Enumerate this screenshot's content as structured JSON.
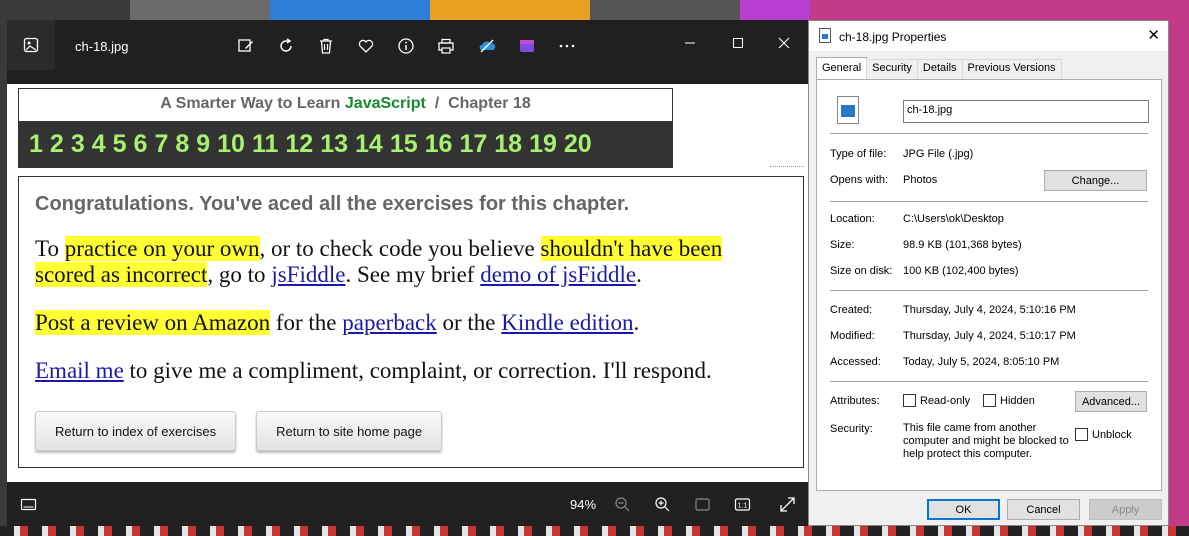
{
  "photos": {
    "file_name": "ch-18.jpg",
    "zoom": "94%",
    "toolbar_icons": [
      "edit-icon",
      "rotate-icon",
      "delete-icon",
      "favorite-icon",
      "info-icon",
      "print-icon",
      "onedrive-icon",
      "clipchamp-icon",
      "more-icon"
    ]
  },
  "page": {
    "title_prefix": "A Smarter Way to Learn",
    "title_js": "JavaScript",
    "title_sep": "/",
    "title_chapter": "Chapter 18",
    "numbers": [
      "1",
      "2",
      "3",
      "4",
      "5",
      "6",
      "7",
      "8",
      "9",
      "10",
      "11",
      "12",
      "13",
      "14",
      "15",
      "16",
      "17",
      "18",
      "19",
      "20"
    ],
    "congrats": "Congratulations. You've aced all the exercises for this chapter.",
    "p1": {
      "a": "To ",
      "hl1": "practice on your own",
      "b": ", or to check code you believe ",
      "hl2": "shouldn't have been scored as incorrect",
      "c": ", go to ",
      "link1": "jsFiddle",
      "d": ". See my brief ",
      "link2": "demo of jsFiddle",
      "e": "."
    },
    "p2": {
      "hl": "Post a review on Amazon",
      "a": " for the ",
      "link1": "paperback",
      "b": " or the ",
      "link2": "Kindle edition",
      "c": "."
    },
    "p3": {
      "link": "Email me",
      "a": " to give me a compliment, complaint, or correction. I'll respond."
    },
    "btn_index": "Return to index of exercises",
    "btn_home": "Return to site home page"
  },
  "props": {
    "title": "ch-18.jpg Properties",
    "tabs": [
      "General",
      "Security",
      "Details",
      "Previous Versions"
    ],
    "file_name": "ch-18.jpg",
    "type_label": "Type of file:",
    "type_value": "JPG File (.jpg)",
    "opens_label": "Opens with:",
    "opens_value": "Photos",
    "change_btn": "Change...",
    "location_label": "Location:",
    "location_value": "C:\\Users\\ok\\Desktop",
    "size_label": "Size:",
    "size_value": "98.9 KB (101,368 bytes)",
    "disk_label": "Size on disk:",
    "disk_value": "100 KB (102,400 bytes)",
    "created_label": "Created:",
    "created_value": "Thursday, July 4, 2024, 5:10:16 PM",
    "modified_label": "Modified:",
    "modified_value": "Thursday, July 4, 2024, 5:10:17 PM",
    "accessed_label": "Accessed:",
    "accessed_value": "Today, July 5, 2024, 8:05:10 PM",
    "attributes_label": "Attributes:",
    "readonly_label": "Read-only",
    "hidden_label": "Hidden",
    "advanced_btn": "Advanced...",
    "security_label": "Security:",
    "security_text": "This file came from another computer and might be blocked to help protect this computer.",
    "unblock_label": "Unblock",
    "ok_btn": "OK",
    "cancel_btn": "Cancel",
    "apply_btn": "Apply"
  }
}
